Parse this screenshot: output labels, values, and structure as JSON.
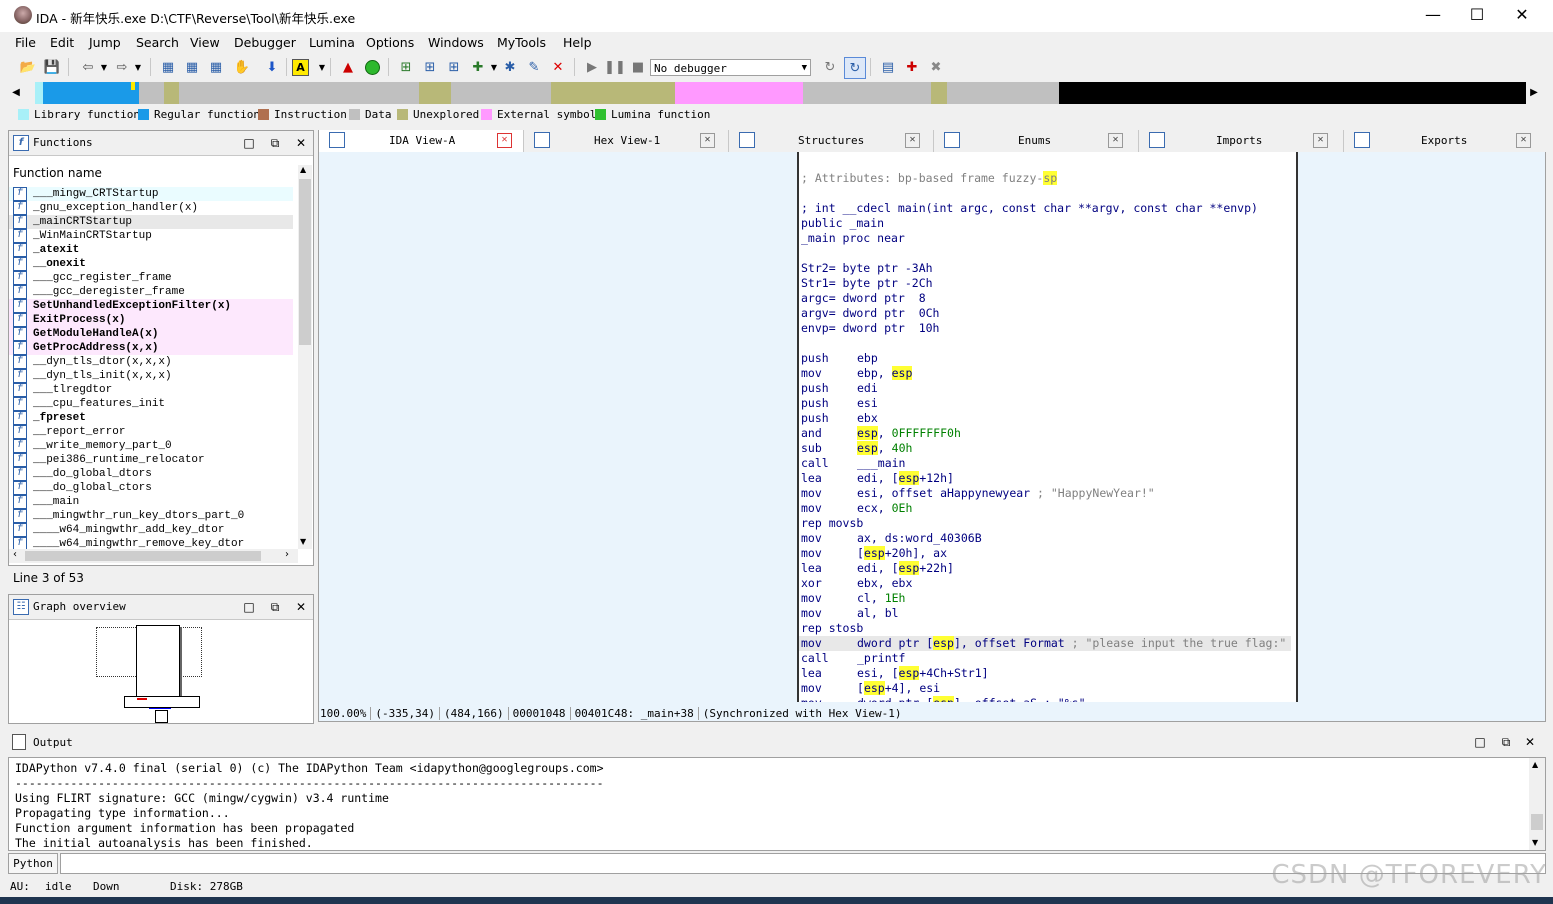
{
  "window": {
    "title": "IDA - 新年快乐.exe D:\\CTF\\Reverse\\Tool\\新年快乐.exe",
    "controls": {
      "minimize": "—",
      "maximize": "☐",
      "close": "✕"
    }
  },
  "menu": [
    "File",
    "Edit",
    "Jump",
    "Search",
    "View",
    "Debugger",
    "Lumina",
    "Options",
    "Windows",
    "MyTools",
    "Help"
  ],
  "toolbar": {
    "debugger_select": "No debugger"
  },
  "legend": [
    {
      "label": "Library function",
      "color": "#a8f0f8"
    },
    {
      "label": "Regular function",
      "color": "#1a9ae8"
    },
    {
      "label": "Instruction",
      "color": "#b07050"
    },
    {
      "label": "Data",
      "color": "#c0c0c0"
    },
    {
      "label": "Unexplored",
      "color": "#b8b878"
    },
    {
      "label": "External symbol",
      "color": "#ff99ff"
    },
    {
      "label": "Lumina function",
      "color": "#30c030"
    }
  ],
  "functions_panel": {
    "title": "Functions",
    "column": "Function name",
    "items": [
      {
        "name": "___mingw_CRTStartup",
        "bold": false,
        "bg": "#eafcff"
      },
      {
        "name": "_gnu_exception_handler(x)",
        "bold": false,
        "bg": "#ffffff"
      },
      {
        "name": "_mainCRTStartup",
        "bold": false,
        "bg": "#e8e8e8"
      },
      {
        "name": "_WinMainCRTStartup",
        "bold": false,
        "bg": "#ffffff"
      },
      {
        "name": "_atexit",
        "bold": true,
        "bg": "#ffffff"
      },
      {
        "name": "__onexit",
        "bold": true,
        "bg": "#ffffff"
      },
      {
        "name": "___gcc_register_frame",
        "bold": false,
        "bg": "#ffffff"
      },
      {
        "name": "___gcc_deregister_frame",
        "bold": false,
        "bg": "#ffffff"
      },
      {
        "name": "SetUnhandledExceptionFilter(x)",
        "bold": true,
        "bg": "#fde8fd"
      },
      {
        "name": "ExitProcess(x)",
        "bold": true,
        "bg": "#fde8fd"
      },
      {
        "name": "GetModuleHandleA(x)",
        "bold": true,
        "bg": "#fde8fd"
      },
      {
        "name": "GetProcAddress(x,x)",
        "bold": true,
        "bg": "#fde8fd"
      },
      {
        "name": "__dyn_tls_dtor(x,x,x)",
        "bold": false,
        "bg": "#ffffff"
      },
      {
        "name": "__dyn_tls_init(x,x,x)",
        "bold": false,
        "bg": "#ffffff"
      },
      {
        "name": "___tlregdtor",
        "bold": false,
        "bg": "#ffffff"
      },
      {
        "name": "___cpu_features_init",
        "bold": false,
        "bg": "#ffffff"
      },
      {
        "name": "_fpreset",
        "bold": true,
        "bg": "#ffffff"
      },
      {
        "name": "__report_error",
        "bold": false,
        "bg": "#ffffff"
      },
      {
        "name": "__write_memory_part_0",
        "bold": false,
        "bg": "#ffffff"
      },
      {
        "name": "__pei386_runtime_relocator",
        "bold": false,
        "bg": "#ffffff"
      },
      {
        "name": "___do_global_dtors",
        "bold": false,
        "bg": "#ffffff"
      },
      {
        "name": "___do_global_ctors",
        "bold": false,
        "bg": "#ffffff"
      },
      {
        "name": "___main",
        "bold": false,
        "bg": "#ffffff"
      },
      {
        "name": "___mingwthr_run_key_dtors_part_0",
        "bold": false,
        "bg": "#ffffff"
      },
      {
        "name": "____w64_mingwthr_add_key_dtor",
        "bold": false,
        "bg": "#ffffff"
      },
      {
        "name": "____w64_mingwthr_remove_key_dtor",
        "bold": false,
        "bg": "#ffffff"
      }
    ],
    "line_status": "Line 3 of 53"
  },
  "graph_panel": {
    "title": "Graph overview"
  },
  "tabs": [
    {
      "label": "IDA View-A",
      "active": true
    },
    {
      "label": "Hex View-1",
      "active": false
    },
    {
      "label": "Structures",
      "active": false
    },
    {
      "label": "Enums",
      "active": false
    },
    {
      "label": "Imports",
      "active": false
    },
    {
      "label": "Exports",
      "active": false
    }
  ],
  "disasm": [
    [
      {
        "t": "; Attributes: bp-based frame fuzzy-",
        "c": "cmt"
      },
      {
        "t": "sp",
        "c": "cmt hl"
      }
    ],
    [],
    [
      {
        "t": "; int __cdecl main(int argc, const char **argv, const char **envp)",
        "c": ""
      }
    ],
    [
      {
        "t": "public _main",
        "c": ""
      }
    ],
    [
      {
        "t": "_main proc near",
        "c": ""
      }
    ],
    [],
    [
      {
        "t": "Str2= byte ptr -3Ah",
        "c": ""
      }
    ],
    [
      {
        "t": "Str1= byte ptr -2Ch",
        "c": ""
      }
    ],
    [
      {
        "t": "argc= dword ptr  8",
        "c": ""
      }
    ],
    [
      {
        "t": "argv= dword ptr  0Ch",
        "c": ""
      }
    ],
    [
      {
        "t": "envp= dword ptr  10h",
        "c": ""
      }
    ],
    [],
    {
      "m": "push",
      "o": [
        {
          "t": "ebp",
          "c": ""
        }
      ]
    },
    {
      "m": "mov",
      "o": [
        {
          "t": "ebp, ",
          "c": ""
        },
        {
          "t": "esp",
          "c": "hl"
        }
      ]
    },
    {
      "m": "push",
      "o": [
        {
          "t": "edi",
          "c": ""
        }
      ]
    },
    {
      "m": "push",
      "o": [
        {
          "t": "esi",
          "c": ""
        }
      ]
    },
    {
      "m": "push",
      "o": [
        {
          "t": "ebx",
          "c": ""
        }
      ]
    },
    {
      "m": "and",
      "o": [
        {
          "t": "esp",
          "c": "hl"
        },
        {
          "t": ", ",
          "c": ""
        },
        {
          "t": "0FFFFFFF0h",
          "c": "num"
        }
      ]
    },
    {
      "m": "sub",
      "o": [
        {
          "t": "esp",
          "c": "hl"
        },
        {
          "t": ", ",
          "c": ""
        },
        {
          "t": "40h",
          "c": "num"
        }
      ]
    },
    {
      "m": "call",
      "o": [
        {
          "t": "___main",
          "c": ""
        }
      ]
    },
    {
      "m": "lea",
      "o": [
        {
          "t": "edi, [",
          "c": ""
        },
        {
          "t": "esp",
          "c": "hl"
        },
        {
          "t": "+12h]",
          "c": ""
        }
      ]
    },
    {
      "m": "mov",
      "o": [
        {
          "t": "esi, offset aHappynewyear ",
          "c": ""
        },
        {
          "t": "; \"HappyNewYear!\"",
          "c": "str"
        }
      ]
    },
    {
      "m": "mov",
      "o": [
        {
          "t": "ecx, ",
          "c": ""
        },
        {
          "t": "0Eh",
          "c": "num"
        }
      ]
    },
    [
      {
        "t": "rep movsb",
        "c": ""
      }
    ],
    {
      "m": "mov",
      "o": [
        {
          "t": "ax, ds:word_40306B",
          "c": ""
        }
      ]
    },
    {
      "m": "mov",
      "o": [
        {
          "t": "[",
          "c": ""
        },
        {
          "t": "esp",
          "c": "hl"
        },
        {
          "t": "+20h], ax",
          "c": ""
        }
      ]
    },
    {
      "m": "lea",
      "o": [
        {
          "t": "edi, [",
          "c": ""
        },
        {
          "t": "esp",
          "c": "hl"
        },
        {
          "t": "+22h]",
          "c": ""
        }
      ]
    },
    {
      "m": "xor",
      "o": [
        {
          "t": "ebx, ebx",
          "c": ""
        }
      ]
    },
    {
      "m": "mov",
      "o": [
        {
          "t": "cl, ",
          "c": ""
        },
        {
          "t": "1Eh",
          "c": "num"
        }
      ]
    },
    {
      "m": "mov",
      "o": [
        {
          "t": "al, bl",
          "c": ""
        }
      ]
    },
    [
      {
        "t": "rep stosb",
        "c": ""
      }
    ],
    {
      "m": "mov",
      "o": [
        {
          "t": "dword ptr [",
          "c": ""
        },
        {
          "t": "esp",
          "c": "hl"
        },
        {
          "t": "], offset Format ",
          "c": ""
        },
        {
          "t": "; \"please input the true flag:\"",
          "c": "str"
        }
      ],
      "sel": true
    },
    {
      "m": "call",
      "o": [
        {
          "t": "_printf",
          "c": ""
        }
      ]
    },
    {
      "m": "lea",
      "o": [
        {
          "t": "esi, [",
          "c": ""
        },
        {
          "t": "esp",
          "c": "hl"
        },
        {
          "t": "+4Ch+Str1]",
          "c": ""
        }
      ]
    },
    {
      "m": "mov",
      "o": [
        {
          "t": "[",
          "c": ""
        },
        {
          "t": "esp",
          "c": "hl"
        },
        {
          "t": "+4], esi",
          "c": ""
        }
      ]
    },
    {
      "m": "mov",
      "o": [
        {
          "t": "dword ptr [",
          "c": ""
        },
        {
          "t": "esp",
          "c": "hl"
        },
        {
          "t": "], offset aS ; \"%s\"",
          "c": ""
        }
      ]
    }
  ],
  "view_status": "100.00% (-335,34) (484,166) 00001048 00401C48: _main+38 (Synchronized with Hex View-1)",
  "output_panel": {
    "title": "Output",
    "lines": [
      "IDAPython v7.4.0 final (serial 0) (c) The IDAPython Team <idapython@googlegroups.com>",
      "-------------------------------------------------------------------------------------",
      "Using FLIRT signature: GCC (mingw/cygwin) v3.4 runtime",
      "Propagating type information...",
      "Function argument information has been propagated",
      "The initial autoanalysis has been finished."
    ],
    "cli_label": "Python"
  },
  "statusbar": {
    "au_label": "AU:",
    "au_state": "idle",
    "direction": "Down",
    "disk": "Disk: 278GB"
  },
  "watermark": "CSDN @TFOREVERY"
}
